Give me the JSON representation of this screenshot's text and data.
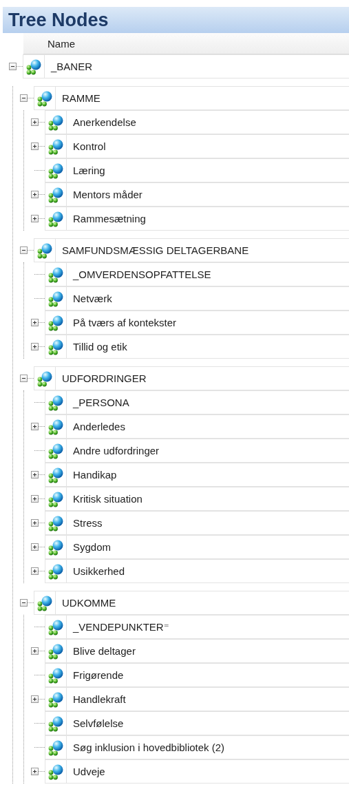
{
  "title": "Tree Nodes",
  "columns": [
    "Name"
  ],
  "nodes": [
    {
      "label": "_BANER",
      "kind": "expanded",
      "children": [
        {
          "label": "RAMME",
          "kind": "expanded",
          "children": [
            {
              "label": "Anerkendelse",
              "kind": "collapsed"
            },
            {
              "label": "Kontrol",
              "kind": "collapsed"
            },
            {
              "label": "Læring",
              "kind": "leaf"
            },
            {
              "label": "Mentors måder",
              "kind": "collapsed"
            },
            {
              "label": "Rammesætning",
              "kind": "collapsed"
            }
          ]
        },
        {
          "label": "SAMFUNDSMÆSSIG DELTAGERBANE",
          "kind": "expanded",
          "children": [
            {
              "label": "_OMVERDENSOPFATTELSE",
              "kind": "leaf"
            },
            {
              "label": "Netværk",
              "kind": "leaf"
            },
            {
              "label": "På tværs af kontekster",
              "kind": "collapsed"
            },
            {
              "label": "Tillid og etik",
              "kind": "collapsed"
            }
          ]
        },
        {
          "label": "UDFORDRINGER",
          "kind": "expanded",
          "children": [
            {
              "label": "_PERSONA",
              "kind": "leaf"
            },
            {
              "label": "Anderledes",
              "kind": "collapsed"
            },
            {
              "label": "Andre udfordringer",
              "kind": "leaf"
            },
            {
              "label": "Handikap",
              "kind": "collapsed"
            },
            {
              "label": "Kritisk situation",
              "kind": "collapsed"
            },
            {
              "label": "Stress",
              "kind": "collapsed"
            },
            {
              "label": "Sygdom",
              "kind": "collapsed"
            },
            {
              "label": "Usikkerhed",
              "kind": "collapsed"
            }
          ]
        },
        {
          "label": "UDKOMME",
          "kind": "expanded",
          "children": [
            {
              "label": "_VENDEPUNKTER⁼",
              "kind": "leaf"
            },
            {
              "label": "Blive deltager",
              "kind": "collapsed"
            },
            {
              "label": "Frigørende",
              "kind": "leaf"
            },
            {
              "label": "Handlekraft",
              "kind": "collapsed"
            },
            {
              "label": "Selvfølelse",
              "kind": "leaf"
            },
            {
              "label": "Søg inklusion i hovedbibliotek (2)",
              "kind": "leaf"
            },
            {
              "label": "Udveje",
              "kind": "collapsed"
            }
          ]
        }
      ]
    }
  ]
}
